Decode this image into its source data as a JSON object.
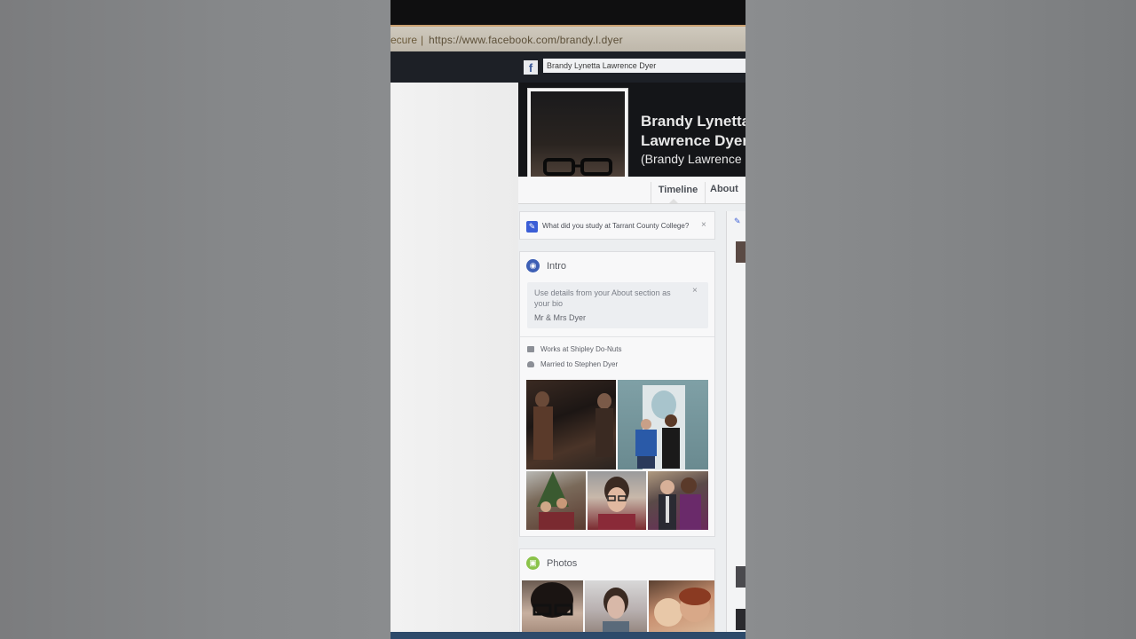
{
  "browser": {
    "secure_label": "ecure",
    "separator": "|",
    "url": "https://www.facebook.com/brandy.l.dyer"
  },
  "fb_header": {
    "logo": "f",
    "search_value": "Brandy Lynetta Lawrence Dyer"
  },
  "profile": {
    "name_line1": "Brandy Lynetta",
    "name_line2": "Lawrence Dyer",
    "alt_name": "(Brandy Lawrence"
  },
  "tabs": {
    "timeline": "Timeline",
    "about": "About"
  },
  "study_prompt": {
    "text": "What did you study at Tarrant County College?",
    "close": "×"
  },
  "intro": {
    "title": "Intro",
    "bio_hint": "Use details from your About section as your bio",
    "bio_value": "Mr & Mrs Dyer",
    "close": "×",
    "facts": [
      {
        "text": "Works at Shipley Do-Nuts",
        "icon": "briefcase-icon"
      },
      {
        "text": "Married to Stephen Dyer",
        "icon": "heart-icon"
      }
    ]
  },
  "photos": {
    "title": "Photos"
  },
  "colors": {
    "fb_blue": "#3b5998",
    "cover_dark": "#141518",
    "photos_green": "#8bc34a"
  }
}
